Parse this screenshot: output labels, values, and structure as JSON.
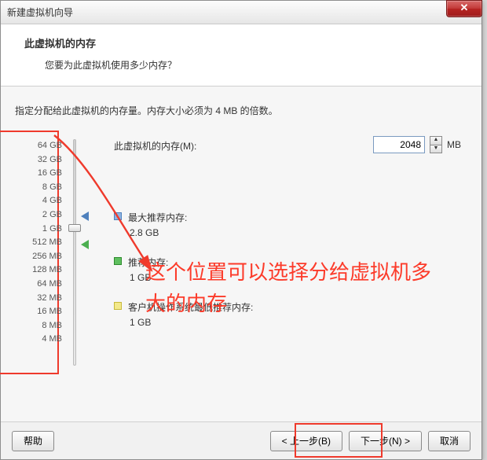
{
  "window": {
    "title": "新建虚拟机向导",
    "close_glyph": "✕"
  },
  "header": {
    "title": "此虚拟机的内存",
    "subtitle": "您要为此虚拟机使用多少内存？"
  },
  "instruction": "指定分配给此虚拟机的内存量。内存大小必须为 4 MB 的倍数。",
  "memory": {
    "label": "此虚拟机的内存(M):",
    "value": "2048",
    "unit": "MB"
  },
  "scale": [
    "64 GB",
    "32 GB",
    "16 GB",
    "8 GB",
    "4 GB",
    "2 GB",
    "1 GB",
    "512 MB",
    "256 MB",
    "128 MB",
    "64 MB",
    "32 MB",
    "16 MB",
    "8 MB",
    "4 MB"
  ],
  "recs": {
    "max_label": "最大推荐内存:",
    "max_value": "2.8 GB",
    "rec_label": "推荐内存:",
    "rec_value": "1 GB",
    "min_label": "客户机操作系统最低推荐内存:",
    "min_value": "1 GB"
  },
  "annotation": {
    "text": "这个位置可以选择分给虚拟机多大的内存"
  },
  "footer": {
    "help": "帮助",
    "back": "< 上一步(B)",
    "next": "下一步(N) >",
    "cancel": "取消"
  }
}
